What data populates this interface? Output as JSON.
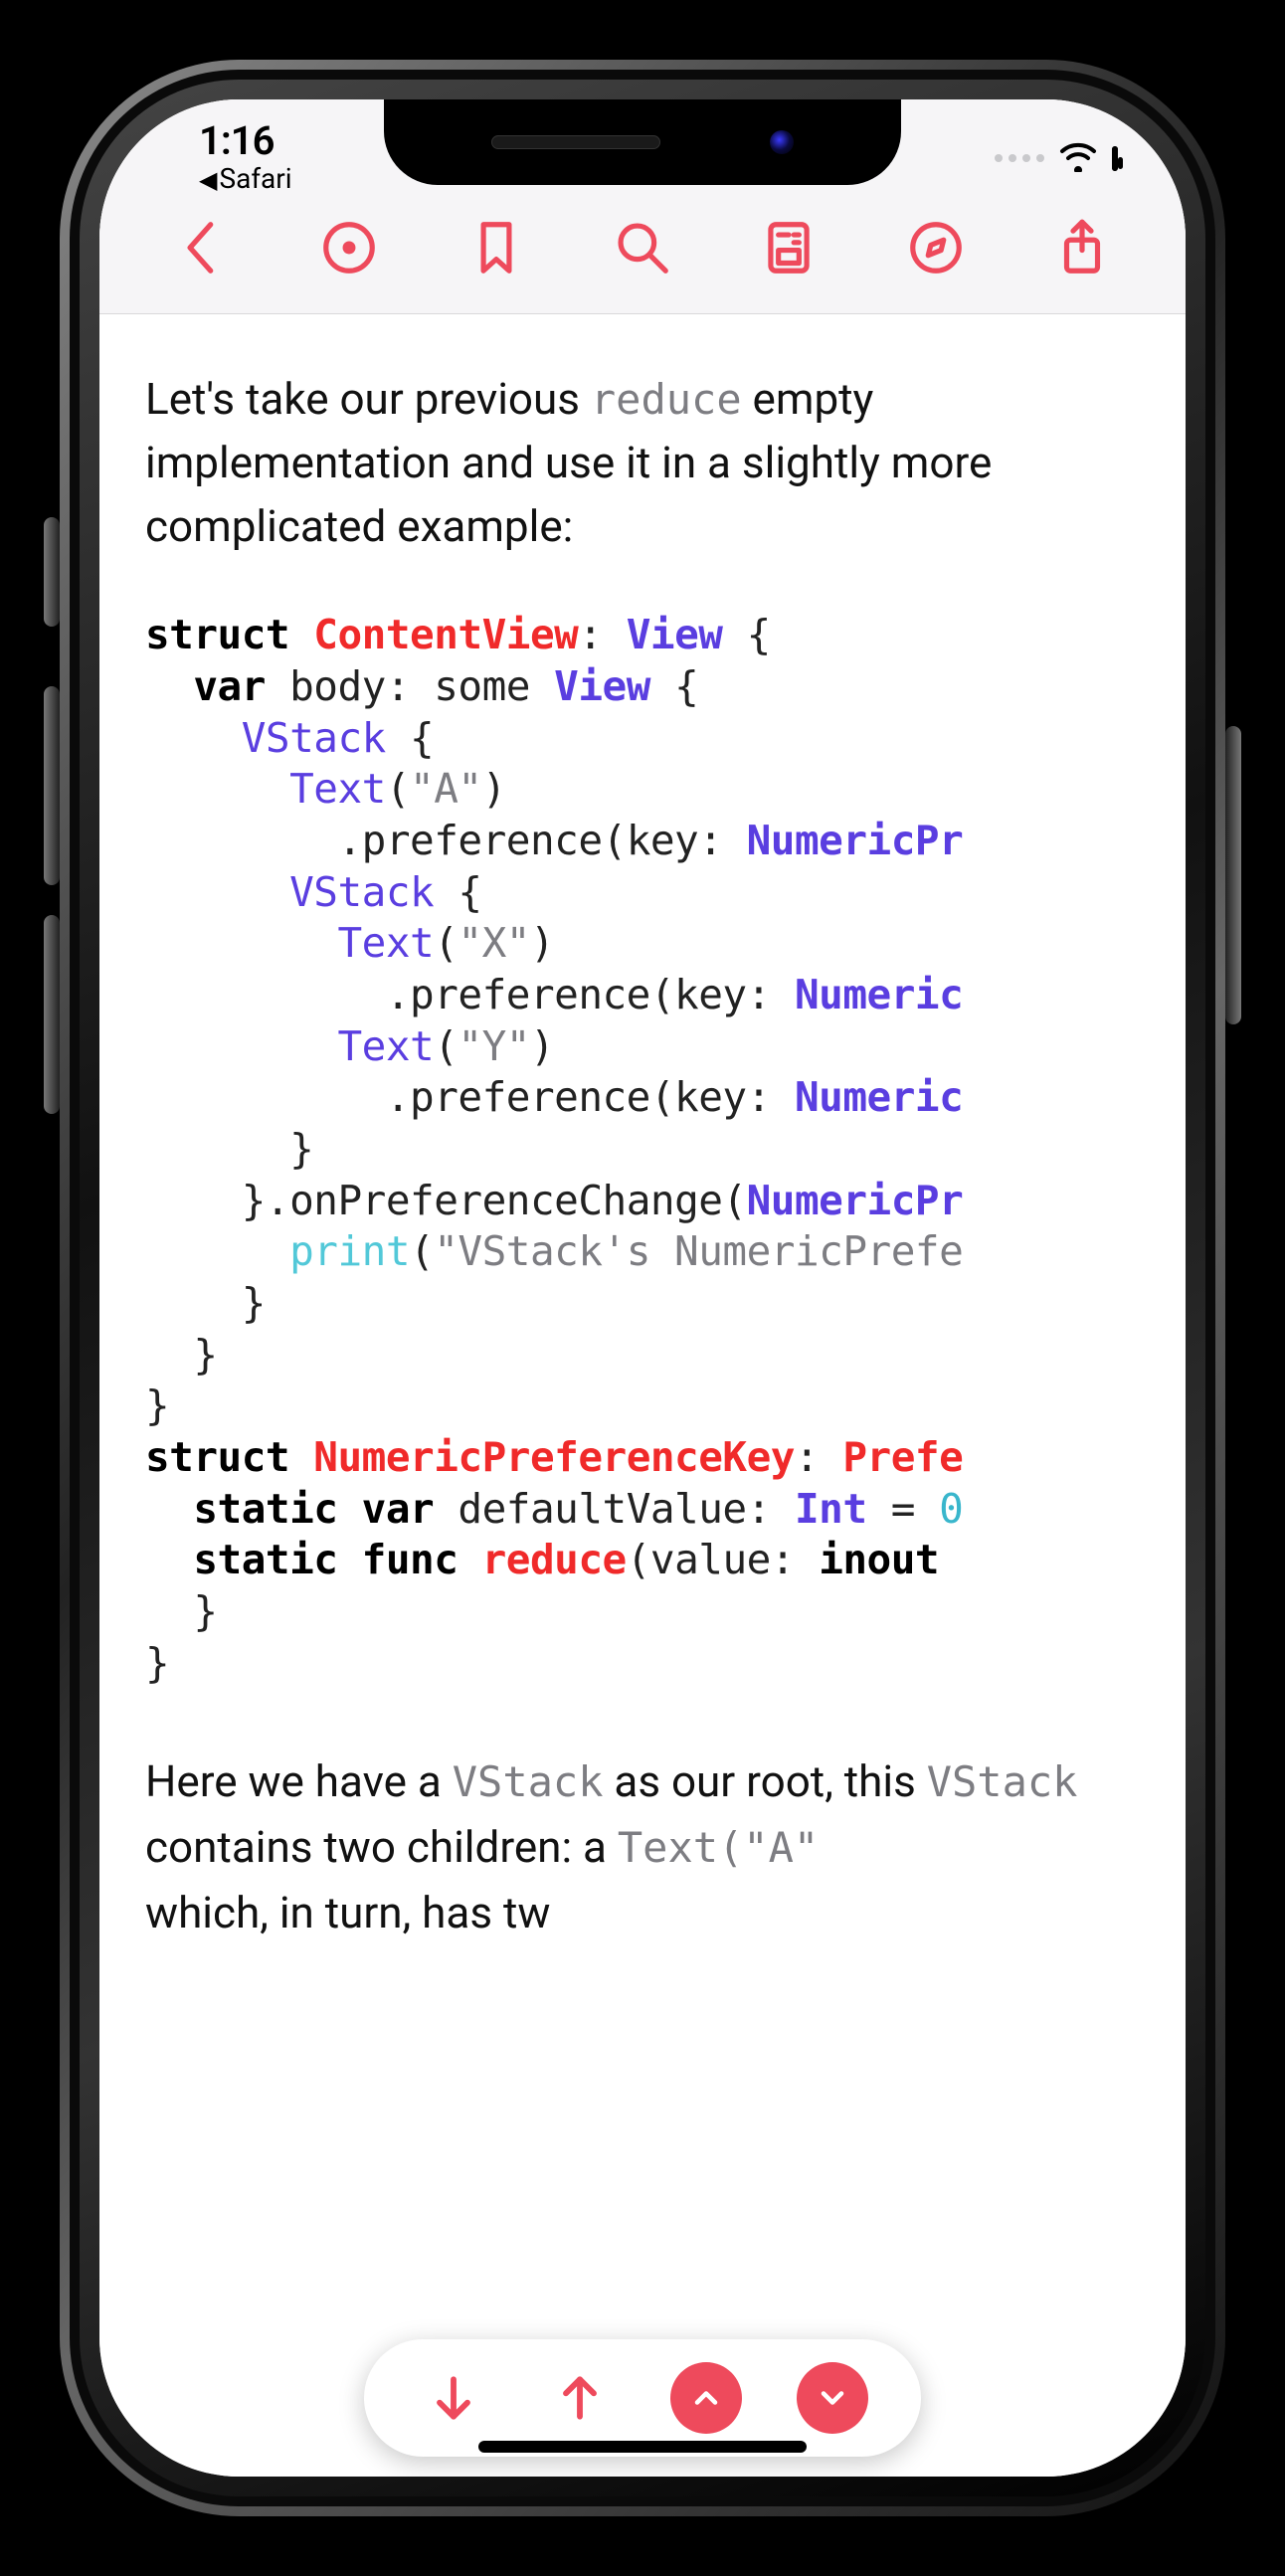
{
  "status": {
    "time": "1:16",
    "breadcrumb_arrow": "◀",
    "breadcrumb_label": "Safari"
  },
  "paragraphs": {
    "intro_p1": "Let's take our previous ",
    "intro_code1": "reduce",
    "intro_p2": " empty implementation and use it in a slightly more complicated example:",
    "after1_a": "Here we have a ",
    "after1_code1": "VStack",
    "after1_b": " as our root, this ",
    "after2_code1": "VStack",
    "after2_b": " contains two children: a ",
    "after3_code1": "Text(\"A\"",
    "after3_mid_hidden": "",
    "after3_tail": " which, in turn, has tw"
  },
  "code": {
    "l01_kw": "struct",
    "l01_sp": " ",
    "l01_type": "ContentView",
    "l01_colon": ": ",
    "l01_proto": "View",
    "l01_brace": " {",
    "l02_indent": "  ",
    "l02_kw": "var",
    "l02_name": " body: some ",
    "l02_type": "View",
    "l02_brace": " {",
    "l03_indent": "    ",
    "l03_fn": "VStack",
    "l03_brace": " {",
    "l04_indent": "      ",
    "l04_fn": "Text",
    "l04_paren": "(",
    "l04_str": "\"A\"",
    "l04_close": ")",
    "l05_indent": "        ",
    "l05_dot": ".preference(key: ",
    "l05_type": "NumericPr",
    "l06_indent": "      ",
    "l06_fn": "VStack",
    "l06_brace": " {",
    "l07_indent": "        ",
    "l07_fn": "Text",
    "l07_paren": "(",
    "l07_str": "\"X\"",
    "l07_close": ")",
    "l08_indent": "          ",
    "l08_dot": ".preference(key: ",
    "l08_type": "Numeric",
    "l09_indent": "        ",
    "l09_fn": "Text",
    "l09_paren": "(",
    "l09_str": "\"Y\"",
    "l09_close": ")",
    "l10_indent": "          ",
    "l10_dot": ".preference(key: ",
    "l10_type": "Numeric",
    "l11_indent": "      ",
    "l11_brace": "}",
    "l12_indent": "    ",
    "l12_close": "}.onPreferenceChange(",
    "l12_type": "NumericPr",
    "l13_indent": "      ",
    "l13_print": "print",
    "l13_paren": "(",
    "l13_str": "\"VStack's NumericPrefe",
    "l14_indent": "    ",
    "l14_brace": "}",
    "l15_indent": "  ",
    "l15_brace": "}",
    "l16_brace": "}",
    "l17_kw": "struct",
    "l17_sp": " ",
    "l17_type": "NumericPreferenceKey",
    "l17_colon": ": ",
    "l17_proto": "Prefe",
    "l18_indent": "  ",
    "l18_kw": "static var",
    "l18_name": " defaultValue: ",
    "l18_type": "Int",
    "l18_eq": " = ",
    "l18_num": "0",
    "l19_indent": "  ",
    "l19_kw": "static func ",
    "l19_fn": "reduce",
    "l19_sig": "(value: ",
    "l19_kw2": "inout ",
    "l20_indent": "  ",
    "l20_brace": "}",
    "l21_brace": "}"
  }
}
